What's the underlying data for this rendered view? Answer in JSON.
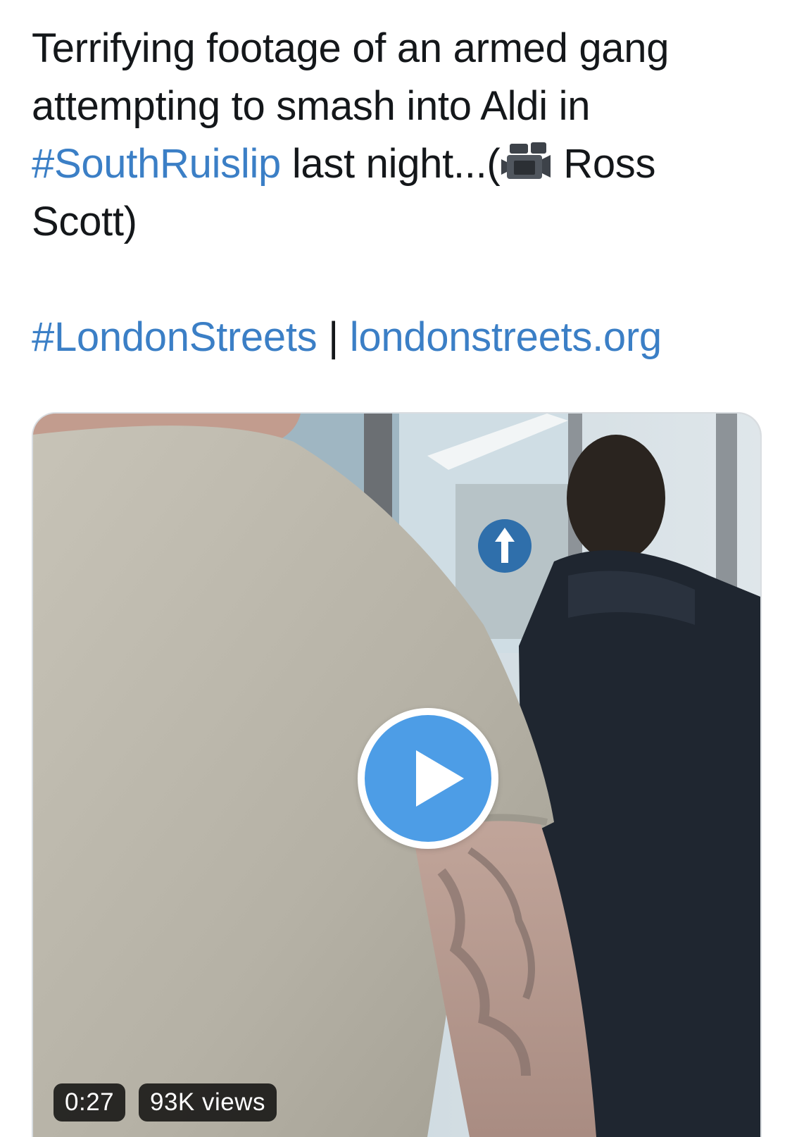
{
  "tweet": {
    "line_1": "Terrifying footage of an armed gang attempting to smash into Aldi in",
    "hashtag_location": "#SouthRuislip",
    "line_2": "last night...(",
    "credit": "Ross Scott)",
    "hashtag_source": "#LondonStreets",
    "separator": "|",
    "website_link": "londonstreets.org",
    "emoji_icon": "movie-camera-icon"
  },
  "video": {
    "duration": "0:27",
    "views": "93K views",
    "play_icon": "play-icon"
  },
  "colors": {
    "link": "#3b7fc6",
    "text": "#14171a",
    "play_button": "#4d9de6"
  }
}
